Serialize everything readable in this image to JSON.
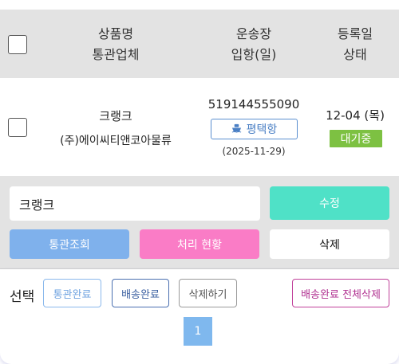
{
  "header": {
    "col_product": "상품명",
    "col_customs_company": "통관업체",
    "col_tracking": "운송장",
    "col_entry_date": "입항(일)",
    "col_reg_date": "등록일",
    "col_status": "상태"
  },
  "row": {
    "product_name": "크랭크",
    "customs_company": "(주)에이씨티앤코아물류",
    "tracking_number": "519144555090",
    "port_icon": "ship-icon",
    "port_label": "평택항",
    "entry_date": "(2025-11-29)",
    "reg_date": "12-04 (목)",
    "status": "대기중"
  },
  "edit": {
    "input_value": "크랭크",
    "edit_label": "수정",
    "customs_check_label": "통관조회",
    "process_status_label": "처리 현황",
    "delete_label": "삭제"
  },
  "bulk": {
    "select_label": "선택",
    "customs_done_label": "통관완료",
    "shipping_done_label": "배송완료",
    "delete_label": "삭제하기",
    "delete_all_shipped_label": "배송완료 전체삭제"
  },
  "pagination": {
    "current_page": "1"
  },
  "colors": {
    "header_bg": "#e3e3e3",
    "status_waiting": "#7dc142",
    "edit_button": "#4fe1c7",
    "customs_button": "#7fb1ec",
    "process_button": "#fa7cc6",
    "page_active": "#7fb8ee"
  }
}
